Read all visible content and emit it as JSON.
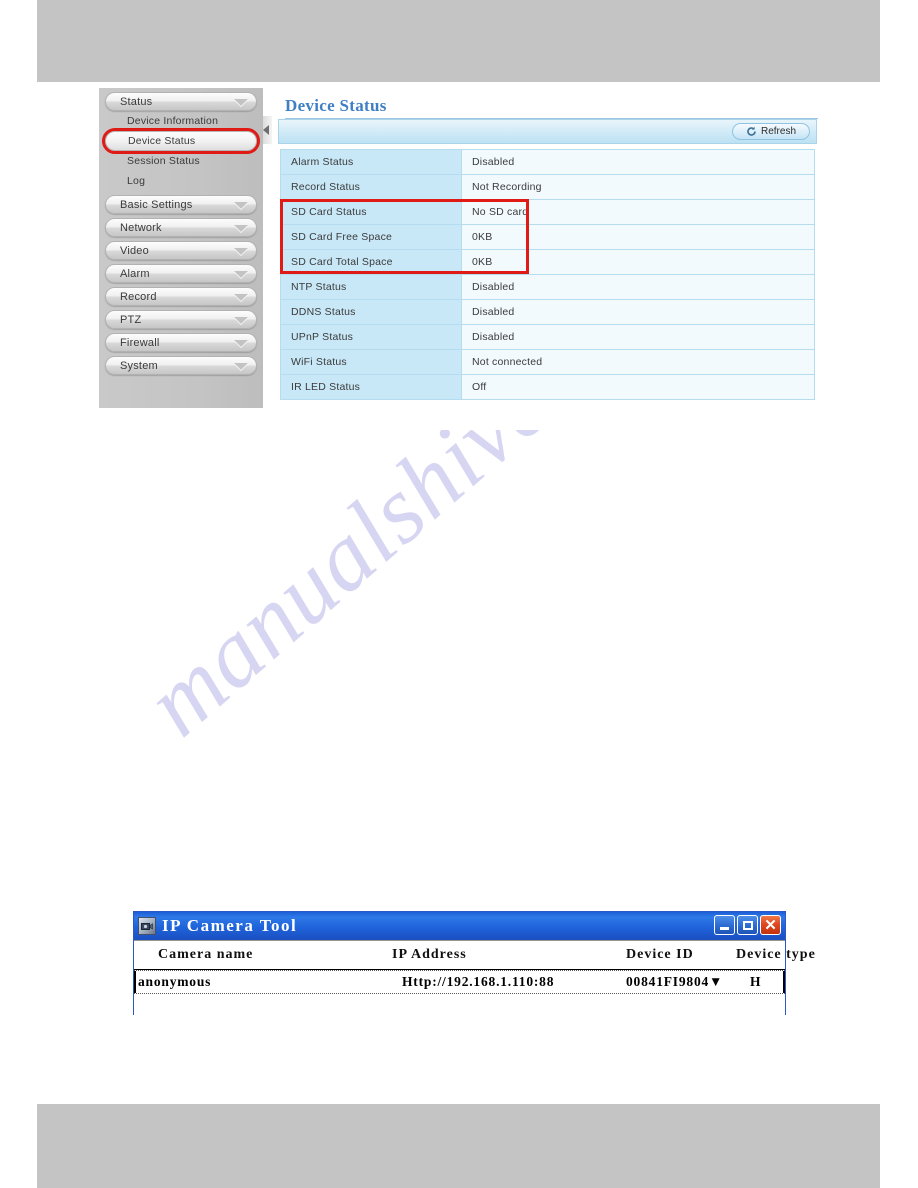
{
  "sidebar": {
    "groups_and_items": [
      {
        "type": "group",
        "label": "Status",
        "icon": "chevron-down-icon"
      },
      {
        "type": "item",
        "label": "Device Information",
        "selected": false,
        "highlighted": false
      },
      {
        "type": "item",
        "label": "Device Status",
        "selected": true,
        "highlighted": true
      },
      {
        "type": "item",
        "label": "Session Status",
        "selected": false,
        "highlighted": false
      },
      {
        "type": "item",
        "label": "Log",
        "selected": false,
        "highlighted": false
      },
      {
        "type": "group",
        "label": "Basic Settings",
        "icon": "chevron-down-icon"
      },
      {
        "type": "group",
        "label": "Network",
        "icon": "chevron-down-icon"
      },
      {
        "type": "group",
        "label": "Video",
        "icon": "chevron-down-icon"
      },
      {
        "type": "group",
        "label": "Alarm",
        "icon": "chevron-down-icon"
      },
      {
        "type": "group",
        "label": "Record",
        "icon": "chevron-down-icon"
      },
      {
        "type": "group",
        "label": "PTZ",
        "icon": "chevron-down-icon"
      },
      {
        "type": "group",
        "label": "Firewall",
        "icon": "chevron-down-icon"
      },
      {
        "type": "group",
        "label": "System",
        "icon": "chevron-down-icon"
      }
    ]
  },
  "content": {
    "page_title": "Device Status",
    "refresh_label": "Refresh",
    "refresh_icon": "refresh-arrow-icon",
    "status_rows": [
      {
        "key": "Alarm Status",
        "value": "Disabled"
      },
      {
        "key": "Record Status",
        "value": "Not Recording"
      },
      {
        "key": "SD Card Status",
        "value": "No SD card"
      },
      {
        "key": "SD Card Free Space",
        "value": "0KB"
      },
      {
        "key": "SD Card Total Space",
        "value": "0KB"
      },
      {
        "key": "NTP Status",
        "value": "Disabled"
      },
      {
        "key": "DDNS Status",
        "value": "Disabled"
      },
      {
        "key": "UPnP Status",
        "value": "Disabled"
      },
      {
        "key": "WiFi Status",
        "value": "Not connected"
      },
      {
        "key": "IR LED Status",
        "value": "Off"
      }
    ]
  },
  "ip_camera_tool": {
    "title": "IP Camera Tool",
    "title_icon": "camera-icon",
    "window_buttons": {
      "minimize": "minimize-icon",
      "maximize": "maximize-icon",
      "close": "close-icon"
    },
    "columns": [
      "Camera name",
      "IP Address",
      "Device ID",
      "Device type"
    ],
    "rows": [
      {
        "camera_name": "anonymous",
        "ip_address": "Http://192.168.1.110:88",
        "device_id": "00841FI9804▼",
        "device_type": "H"
      }
    ]
  },
  "watermark": {
    "text": "manualshive.com"
  },
  "colors": {
    "accent_blue": "#3f7fc4",
    "highlight_red": "#e01b16",
    "table_key_bg": "#c8e8f7",
    "band_gray": "#c4c4c4",
    "titlebar_blue": "#1f63da"
  }
}
